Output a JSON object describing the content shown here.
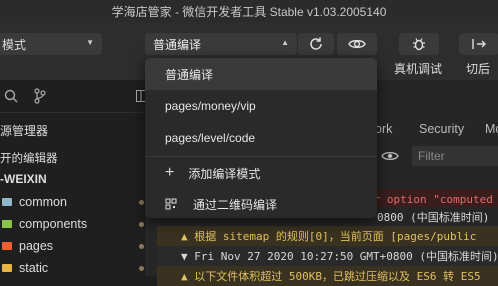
{
  "window": {
    "title": "学海店管家 - 微信开发者工具 Stable v1.03.2005140"
  },
  "toolbar": {
    "mode_label": "模式",
    "compile_selected": "普通编译",
    "refresh_icon": "refresh-icon",
    "preview_icon": "eye-icon",
    "debug_icon": "bug-icon",
    "debug_label": "真机调试",
    "backend_icon": "switch-backend-icon",
    "backend_label": "切后台"
  },
  "sidebar": {
    "resource_manager": "源管理器",
    "open_editors": "开的编辑器",
    "project_root": "-WEIXIN",
    "items": [
      {
        "label": "common",
        "color": "#8fb8c9"
      },
      {
        "label": "components",
        "color": "#8bc34a"
      },
      {
        "label": "pages",
        "color": "#f06030"
      },
      {
        "label": "static",
        "color": "#e7b445"
      }
    ]
  },
  "main": {
    "tabs": [
      "ork",
      "Security",
      "Mo"
    ],
    "filter_placeholder": "Filter",
    "logs": [
      {
        "text": "or option \"computed",
        "color": "#e06a6a",
        "bg": "#3a1e1e"
      },
      {
        "text": "0800 (中国标准时间)",
        "color": "#d8d8d8",
        "bg": "#262626"
      },
      {
        "text": "▲ 根据 sitemap 的规则[0]，当前页面 [pages/public",
        "color": "#e0c060",
        "bg": "#3a3220"
      },
      {
        "text": "▼ Fri Nov 27 2020 10:27:50 GMT+0800 (中国标准时间)",
        "color": "#d8d8d8",
        "bg": "#2a2a2a"
      },
      {
        "text": "▲ 以下文件体积超过 500KB，已跳过压缩以及 ES6 转 ES5",
        "color": "#e0c060",
        "bg": "#3a3220"
      }
    ]
  },
  "dropdown": {
    "items": [
      {
        "label": "普通编译",
        "selected": true
      },
      {
        "label": "pages/money/vip",
        "selected": false
      },
      {
        "label": "pages/level/code",
        "selected": false
      }
    ],
    "add_mode": "添加编译模式",
    "qr_compile": "通过二维码编译"
  }
}
